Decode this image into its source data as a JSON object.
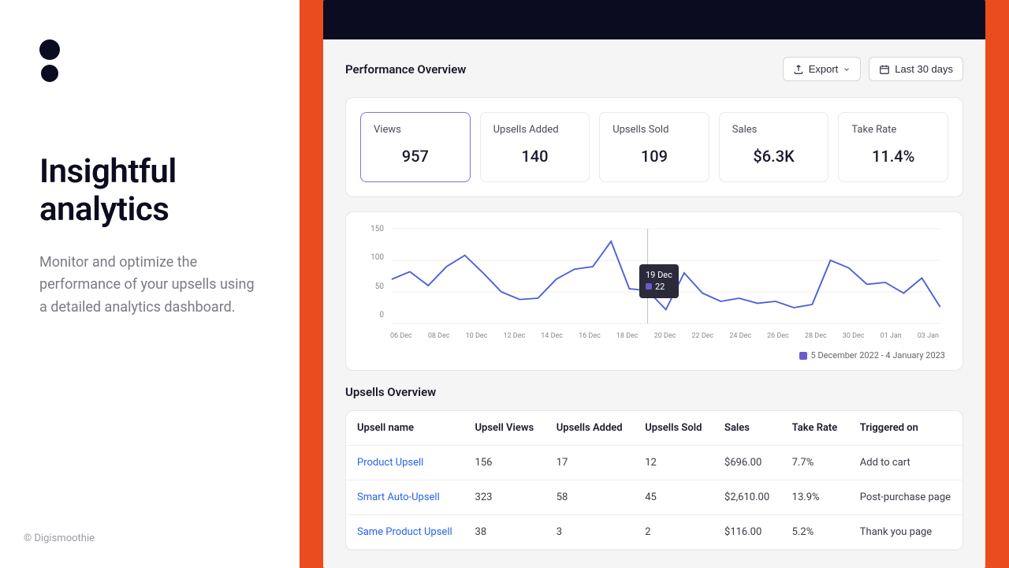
{
  "left": {
    "heading": "Insightful analytics",
    "subtext": "Monitor and optimize the performance of your upsells using a detailed analytics dashboard.",
    "footer": "© Digismoothie"
  },
  "header": {
    "title": "Performance Overview",
    "export_label": "Export",
    "daterange_label": "Last 30 days"
  },
  "metrics": [
    {
      "label": "Views",
      "value": "957",
      "active": true
    },
    {
      "label": "Upsells Added",
      "value": "140"
    },
    {
      "label": "Upsells Sold",
      "value": "109"
    },
    {
      "label": "Sales",
      "value": "$6.3K"
    },
    {
      "label": "Take Rate",
      "value": "11.4%"
    }
  ],
  "chart_data": {
    "type": "line",
    "ylim": [
      0,
      150
    ],
    "ylabel": "",
    "xlabel": "",
    "yticks": [
      0,
      50,
      100,
      150
    ],
    "xticks": [
      "06 Dec",
      "08 Dec",
      "10 Dec",
      "12 Dec",
      "14 Dec",
      "16 Dec",
      "18 Dec",
      "20 Dec",
      "22 Dec",
      "24 Dec",
      "26 Dec",
      "28 Dec",
      "30 Dec",
      "01 Jan",
      "03 Jan"
    ],
    "categories": [
      "05 Dec",
      "06 Dec",
      "07 Dec",
      "08 Dec",
      "09 Dec",
      "10 Dec",
      "11 Dec",
      "12 Dec",
      "13 Dec",
      "14 Dec",
      "15 Dec",
      "16 Dec",
      "17 Dec",
      "18 Dec",
      "19 Dec",
      "20 Dec",
      "21 Dec",
      "22 Dec",
      "23 Dec",
      "24 Dec",
      "25 Dec",
      "26 Dec",
      "27 Dec",
      "28 Dec",
      "29 Dec",
      "30 Dec",
      "31 Dec",
      "01 Jan",
      "02 Jan",
      "03 Jan",
      "04 Jan"
    ],
    "values": [
      70,
      82,
      60,
      90,
      108,
      80,
      50,
      38,
      40,
      70,
      86,
      90,
      130,
      55,
      52,
      22,
      80,
      48,
      35,
      40,
      32,
      35,
      25,
      30,
      100,
      88,
      62,
      65,
      48,
      72,
      26
    ],
    "tooltip": {
      "date": "19 Dec",
      "value": "22"
    },
    "legend": "5 December 2022 - 4 January 2023"
  },
  "table": {
    "title": "Upsells Overview",
    "columns": [
      "Upsell name",
      "Upsell Views",
      "Upsells Added",
      "Upsells Sold",
      "Sales",
      "Take Rate",
      "Triggered on"
    ],
    "rows": [
      {
        "name": "Product Upsell",
        "views": "156",
        "added": "17",
        "sold": "12",
        "sales": "$696.00",
        "rate": "7.7%",
        "trigger": "Add to cart"
      },
      {
        "name": "Smart Auto-Upsell",
        "views": "323",
        "added": "58",
        "sold": "45",
        "sales": "$2,610.00",
        "rate": "13.9%",
        "trigger": "Post-purchase page"
      },
      {
        "name": "Same Product Upsell",
        "views": "38",
        "added": "3",
        "sold": "2",
        "sales": "$116.00",
        "rate": "5.2%",
        "trigger": "Thank you page"
      }
    ]
  }
}
